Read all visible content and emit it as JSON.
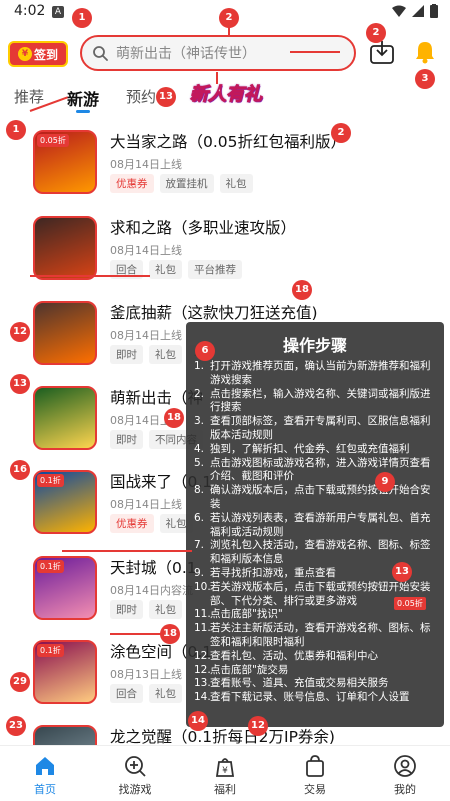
{
  "status": {
    "time": "4:02",
    "a_badge": "A"
  },
  "header": {
    "checkin_label": "签到",
    "checkin_coin": "¥",
    "search_placeholder": "萌新出击（神话传世）"
  },
  "tabs": [
    {
      "label": "推荐",
      "active": false
    },
    {
      "label": "新游",
      "active": true
    },
    {
      "label": "预约",
      "active": false
    }
  ],
  "promo_banner": "新人有礼",
  "games": [
    {
      "name": "大当家之路（0.05折红包福利版）",
      "date": "08月14日上线",
      "tags": [
        "优惠券",
        "放置挂机",
        "礼包"
      ],
      "discount": "0.05折",
      "colors": [
        "#b71c1c",
        "#ff9800"
      ]
    },
    {
      "name": "求和之路（多职业速攻版）",
      "date": "08月14日上线",
      "tags": [
        "回合",
        "礼包",
        "平台推荐"
      ],
      "discount": "",
      "colors": [
        "#3e2723",
        "#d84315"
      ]
    },
    {
      "name": "釜底抽薪（这款快刀狂送充值)",
      "date": "08月14日上线",
      "tags": [
        "即时",
        "礼包",
        "平"
      ],
      "discount": "",
      "colors": [
        "#4e342e",
        "#ff6f00"
      ]
    },
    {
      "name": "萌新出击（神",
      "date": "08月14日上线",
      "tags": [
        "即时",
        "不同内容"
      ],
      "discount": "",
      "colors": [
        "#1b5e20",
        "#ffd54f"
      ]
    },
    {
      "name": "国战来了（0.1",
      "date": "08月14日上线",
      "tags": [
        "优惠券",
        "礼包"
      ],
      "discount": "0.1折",
      "colors": [
        "#0d47a1",
        "#ffb300"
      ]
    },
    {
      "name": "天封城（0.1",
      "date": "08月14日内容流",
      "tags": [
        "即时",
        "礼包"
      ],
      "discount": "0.1折",
      "colors": [
        "#6a1b9a",
        "#f48fb1"
      ]
    },
    {
      "name": "涂色空间（0.1",
      "date": "08月13日上线",
      "tags": [
        "回合",
        "礼包"
      ],
      "discount": "0.1折",
      "colors": [
        "#880e4f",
        "#ffcc80"
      ]
    },
    {
      "name": "龙之觉醒（0.1折每日2万IP券余)",
      "date": "",
      "tags": [],
      "discount": "",
      "colors": [
        "#37474f",
        "#90a4ae"
      ]
    }
  ],
  "overlay": {
    "title": "操作步骤",
    "steps": [
      {
        "num": "1.",
        "text": "打开游戏推荐页面，确认当前为新游推荐和福利游戏搜索"
      },
      {
        "num": "2.",
        "text": "点击搜索栏，输入游戏名称、关键词或福利版进行搜索"
      },
      {
        "num": "3.",
        "text": "查看顶部标签，查看开专属利司、区服信息福利版本活动规则"
      },
      {
        "num": "4.",
        "text": "独到，了解折扣、代金券、红包或充值福利"
      },
      {
        "num": "5.",
        "text": "点击游戏图标或游戏名称，进入游戏详情页查看介绍、截图和评价"
      },
      {
        "num": "8.",
        "text": "确认游戏版本后，点击下载或预约按钮开始合安装"
      },
      {
        "num": "6.",
        "text": "若认游戏列表表，查看游新用户专属礼包、首充福利或活动规则"
      },
      {
        "num": "7.",
        "text": "浏览礼包入技活动，查看游戏名称、图标、标签和福利版本信息"
      },
      {
        "num": "9.",
        "text": "若寻找折扣游戏，重点查看"
      },
      {
        "num": "10.",
        "text": "若关游戏版本后，点击下载或预约按钮开始安装部、下代分类、排行或更多游戏"
      },
      {
        "num": "11.",
        "text": "点击底部\"找识\""
      },
      {
        "num": "11.",
        "text": "若关注主新版活动，查看开游戏名称、图标、标签和福利和限时福利"
      },
      {
        "num": "12.",
        "text": "查看礼包、活动、优惠券和福利中心"
      },
      {
        "num": "12.",
        "text": "点击底部\"旋交易"
      },
      {
        "num": "13.",
        "text": "查看账号、道具、充值或交易相关服务"
      },
      {
        "num": "14.",
        "text": "查看下载记录、账号信息、订单和个人设置"
      }
    ],
    "mini_discount": "0.05折"
  },
  "markers": [
    "1",
    "2",
    "2",
    "3",
    "13",
    "1",
    "2",
    "18",
    "12",
    "13",
    "16",
    "18",
    "9",
    "6",
    "13",
    "18",
    "29",
    "23",
    "14",
    "12",
    "29",
    "23"
  ],
  "bottom_nav": [
    {
      "label": "首页",
      "icon": "home-icon",
      "active": true
    },
    {
      "label": "找游戏",
      "icon": "game-search-icon",
      "active": false
    },
    {
      "label": "福利",
      "icon": "gift-yuan-icon",
      "active": false
    },
    {
      "label": "交易",
      "icon": "shopping-bag-icon",
      "active": false
    },
    {
      "label": "我的",
      "icon": "user-icon",
      "active": false
    }
  ],
  "colors": {
    "accent": "#1e88e5",
    "annotation": "#e53935"
  }
}
